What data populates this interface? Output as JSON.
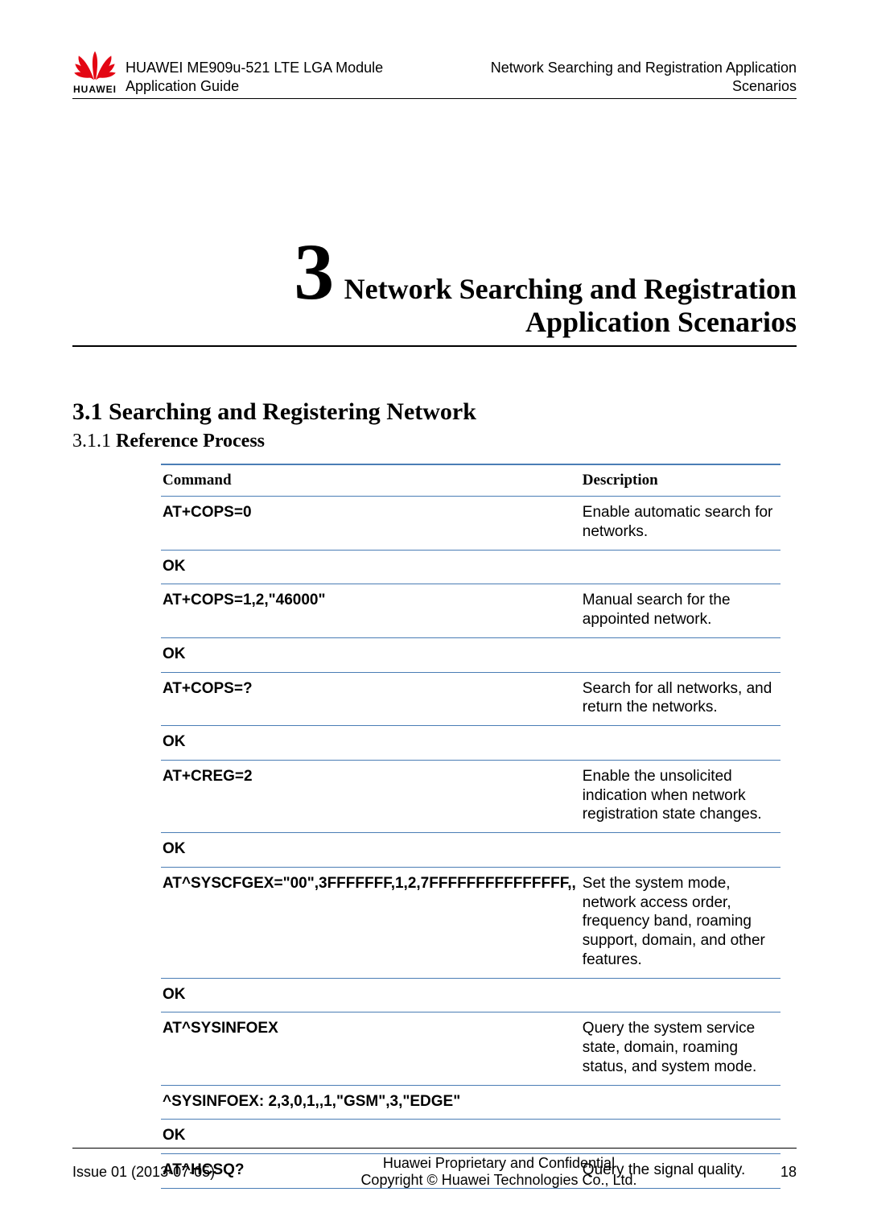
{
  "header": {
    "brand": "HUAWEI",
    "left_line1": "HUAWEI ME909u-521 LTE LGA Module",
    "left_line2": "Application Guide",
    "right_line1": "Network Searching and Registration Application",
    "right_line2": "Scenarios"
  },
  "chapter": {
    "number": "3",
    "title_line1": "Network Searching and Registration",
    "title_line2": "Application Scenarios"
  },
  "section": {
    "h1": "3.1 Searching and Registering Network",
    "h2_num": "3.1.1 ",
    "h2_txt": "Reference Process"
  },
  "table": {
    "head_cmd": "Command",
    "head_desc": "Description",
    "rows": [
      {
        "cmd": "AT+COPS=0",
        "desc": "Enable automatic search for networks."
      },
      {
        "cmd": "OK",
        "desc": ""
      },
      {
        "cmd": "AT+COPS=1,2,\"46000\"",
        "desc": "Manual search for the appointed network."
      },
      {
        "cmd": "OK",
        "desc": ""
      },
      {
        "cmd": "AT+COPS=?",
        "desc": "Search for all networks, and return the networks."
      },
      {
        "cmd": "OK",
        "desc": ""
      },
      {
        "cmd": "AT+CREG=2",
        "desc": "Enable the unsolicited indication when network registration state changes."
      },
      {
        "cmd": "OK",
        "desc": ""
      },
      {
        "cmd": "AT^SYSCFGEX=\"00\",3FFFFFFF,1,2,7FFFFFFFFFFFFFFF,,",
        "desc": "Set the system mode, network access order, frequency band, roaming support, domain, and other features."
      },
      {
        "cmd": "OK",
        "desc": ""
      },
      {
        "cmd": "AT^SYSINFOEX",
        "desc": "Query the system service state, domain, roaming status, and system mode."
      },
      {
        "cmd": "^SYSINFOEX: 2,3,0,1,,1,\"GSM\",3,\"EDGE\"",
        "desc": ""
      },
      {
        "cmd": "OK",
        "desc": ""
      },
      {
        "cmd": "AT^HCSQ?",
        "desc": "Query the signal quality."
      }
    ]
  },
  "footer": {
    "left": "Issue 01 (2013-07-05)",
    "center_line1": "Huawei Proprietary and Confidential",
    "center_line2": "Copyright © Huawei Technologies Co., Ltd.",
    "right": "18"
  }
}
